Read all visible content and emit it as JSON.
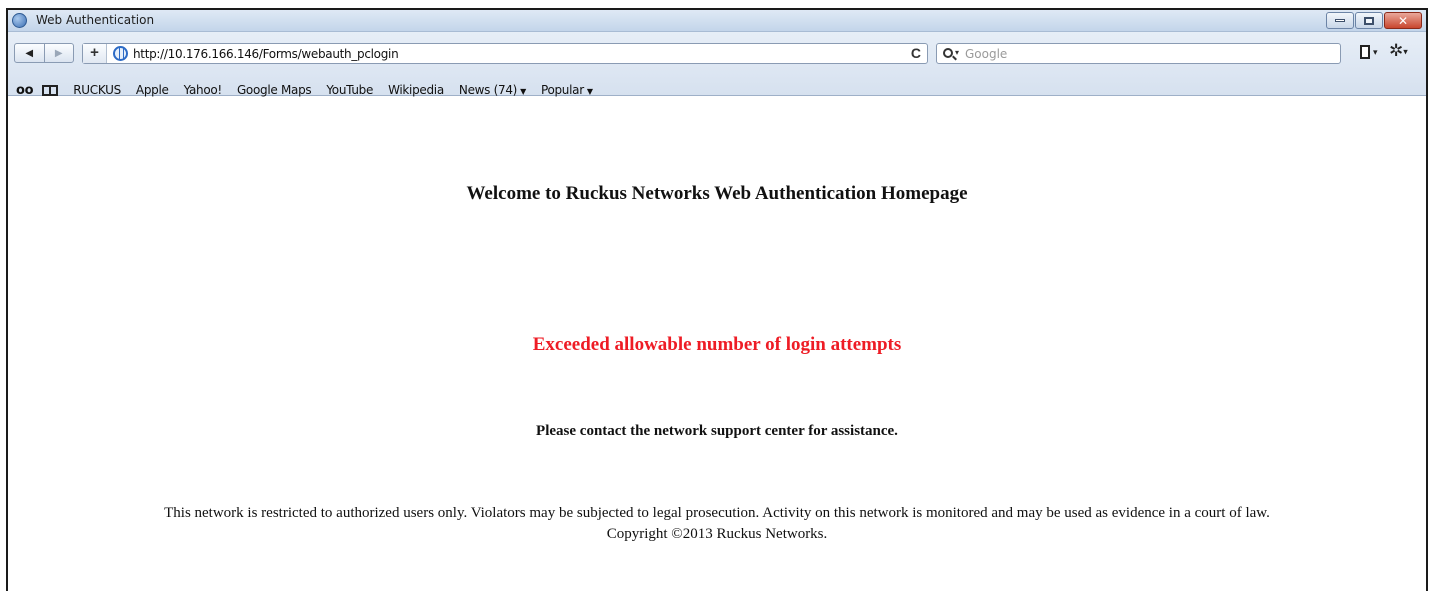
{
  "window": {
    "title": "Web Authentication"
  },
  "toolbar": {
    "back_label": "◀",
    "forward_label": "▶",
    "add_label": "+",
    "url": "http://10.176.166.146/Forms/webauth_pclogin",
    "reload_label": "C",
    "search_placeholder": "Google"
  },
  "bookmarks": {
    "items": [
      {
        "label": "RUCKUS"
      },
      {
        "label": "Apple"
      },
      {
        "label": "Yahoo!"
      },
      {
        "label": "Google Maps"
      },
      {
        "label": "YouTube"
      },
      {
        "label": "Wikipedia"
      },
      {
        "label": "News (74)"
      },
      {
        "label": "Popular"
      }
    ]
  },
  "page": {
    "welcome": "Welcome to Ruckus Networks Web Authentication Homepage",
    "error": "Exceeded allowable number of login attempts",
    "contact": "Please contact the network support center for assistance.",
    "legal": "This network is restricted to authorized users only. Violators may be subjected to legal prosecution. Activity on this network is monitored and may be used as evidence in a court of law.",
    "copyright": "Copyright ©2013 Ruckus Networks."
  },
  "colors": {
    "error": "#ee1c25",
    "titlebar": "#c3d5ea"
  }
}
